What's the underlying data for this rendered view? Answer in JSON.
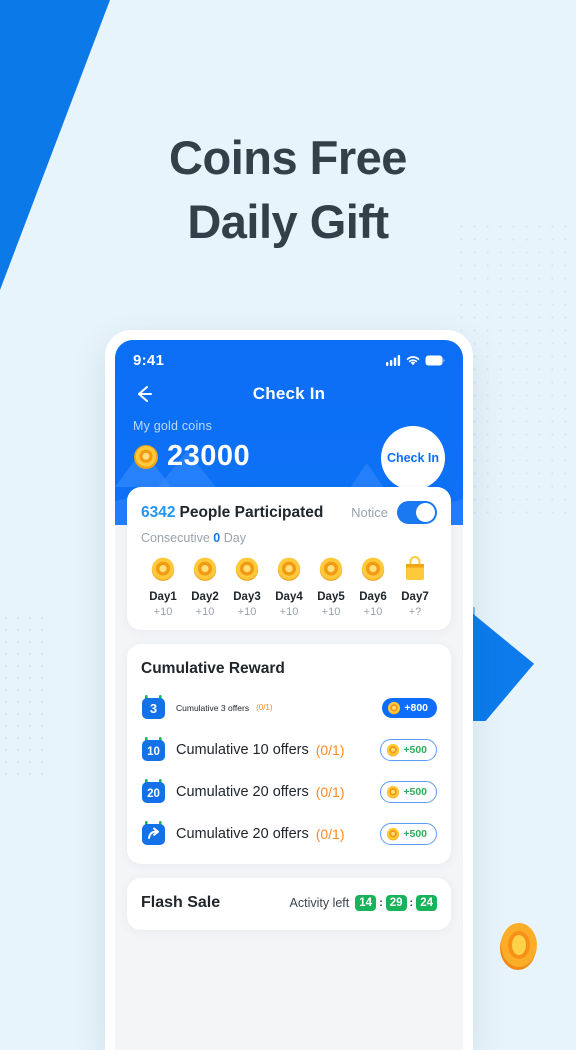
{
  "headline": {
    "line1": "Coins Free",
    "line2": "Daily Gift"
  },
  "phone": {
    "statusbar": {
      "time": "9:41",
      "signal_icon": "signal-bars-icon",
      "wifi_icon": "wifi-icon",
      "battery_icon": "battery-icon"
    },
    "navbar": {
      "back_icon": "back-arrow-icon",
      "title": "Check In"
    },
    "balance": {
      "label": "My gold coins",
      "coin_icon": "gold-coin-icon",
      "amount": "23000"
    },
    "checkin_button": {
      "label": "Check In"
    },
    "participation": {
      "count": "6342",
      "text": "People Participated",
      "notice_label": "Notice",
      "notice_on": true,
      "consecutive_prefix": "Consecutive",
      "consecutive_value": "0",
      "consecutive_suffix": "Day",
      "days": [
        {
          "icon": "gold-coin-icon",
          "label": "Day1",
          "amount": "+10"
        },
        {
          "icon": "gold-coin-icon",
          "label": "Day2",
          "amount": "+10"
        },
        {
          "icon": "gold-coin-icon",
          "label": "Day3",
          "amount": "+10"
        },
        {
          "icon": "gold-coin-icon",
          "label": "Day4",
          "amount": "+10"
        },
        {
          "icon": "gold-coin-icon",
          "label": "Day5",
          "amount": "+10"
        },
        {
          "icon": "gold-coin-icon",
          "label": "Day6",
          "amount": "+10"
        },
        {
          "icon": "gift-bag-icon",
          "label": "Day7",
          "amount": "+?"
        }
      ]
    },
    "cumulative": {
      "title": "Cumulative Reward",
      "rows": [
        {
          "icon": "calendar-3-icon",
          "badge": "3",
          "name": "Cumulative 3 offers",
          "progress": "(0/1)",
          "reward": "+800",
          "style": "filled"
        },
        {
          "icon": "calendar-10-icon",
          "badge": "10",
          "name": "Cumulative 10 offers",
          "progress": "(0/1)",
          "reward": "+500",
          "style": "outline"
        },
        {
          "icon": "calendar-20-icon",
          "badge": "20",
          "name": "Cumulative 20 offers",
          "progress": "(0/1)",
          "reward": "+500",
          "style": "outline"
        },
        {
          "icon": "calendar-share-icon",
          "badge": "",
          "name": "Cumulative 20 offers",
          "progress": "(0/1)",
          "reward": "+500",
          "style": "outline"
        }
      ]
    },
    "flash": {
      "title": "Flash Sale",
      "activity_label": "Activity left",
      "hours": "14",
      "minutes": "29",
      "seconds": "24",
      "separator": ":"
    }
  },
  "colors": {
    "page_bg": "#e8f4fb",
    "brand_blue": "#0d6efd",
    "accent_blue": "#2196f3",
    "orange": "#ff8a1f",
    "green": "#19b35c",
    "gold": "#f5b21d",
    "heading": "#33404a"
  }
}
